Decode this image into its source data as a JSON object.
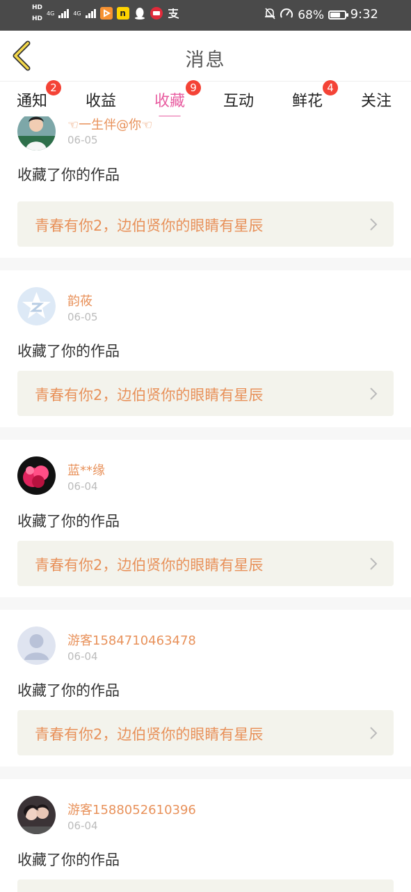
{
  "status_bar": {
    "hd1": "HD",
    "hd2": "HD",
    "net1": "4G",
    "net2": "4G",
    "battery_pct": "68%",
    "battery_level": 0.68,
    "time": "9:32",
    "app_icons": [
      "video-app-icon",
      "n-app-icon",
      "qq-icon",
      "shopping-app-icon",
      "alipay-icon"
    ]
  },
  "header": {
    "title": "消息"
  },
  "tabs": [
    {
      "label": "通知",
      "badge": "2"
    },
    {
      "label": "收益",
      "badge": ""
    },
    {
      "label": "收藏",
      "badge": "9",
      "active": true
    },
    {
      "label": "互动",
      "badge": ""
    },
    {
      "label": "鲜花",
      "badge": "4"
    },
    {
      "label": "关注",
      "badge": ""
    }
  ],
  "colors": {
    "accent": "#e85ca0",
    "name": "#e8915a",
    "badge": "#f44336",
    "card_bg": "#f3f3ec"
  },
  "feed": [
    {
      "name": "☜一生伴@你☜",
      "date": "06-05",
      "action": "收藏了你的作品",
      "work_title": "青春有你2，边伯贤你的眼睛有星辰",
      "avatar": "photo-avatar"
    },
    {
      "name": "韵莜",
      "date": "06-05",
      "action": "收藏了你的作品",
      "work_title": "青春有你2，边伯贤你的眼睛有星辰",
      "avatar": "qzone-star-avatar"
    },
    {
      "name": "蓝**缘",
      "date": "06-04",
      "action": "收藏了你的作品",
      "work_title": "青春有你2，边伯贤你的眼睛有星辰",
      "avatar": "flower-avatar"
    },
    {
      "name": "游客1584710463478",
      "date": "06-04",
      "action": "收藏了你的作品",
      "work_title": "青春有你2，边伯贤你的眼睛有星辰",
      "avatar": "default-person-avatar"
    },
    {
      "name": "游客1588052610396",
      "date": "06-04",
      "action": "收藏了你的作品",
      "work_title": "",
      "avatar": "couple-photo-avatar"
    }
  ]
}
